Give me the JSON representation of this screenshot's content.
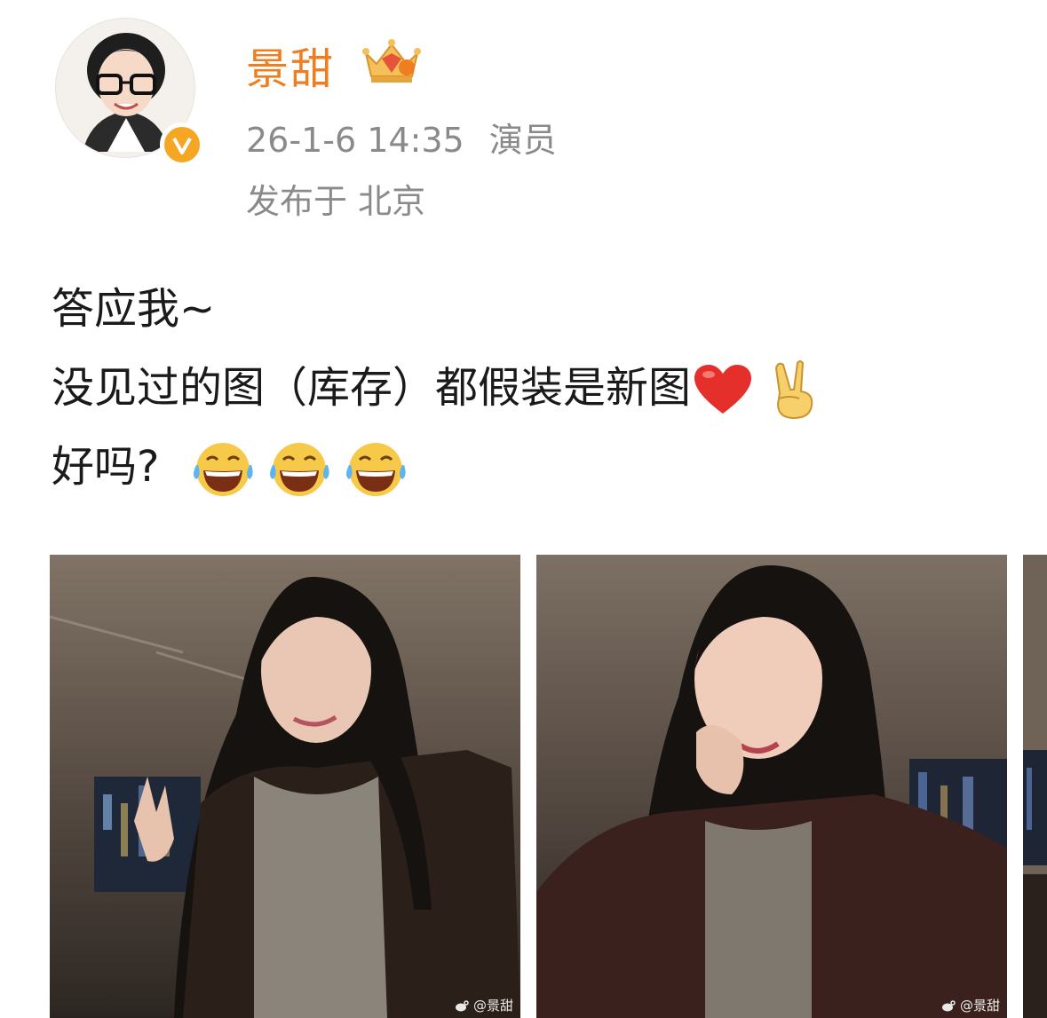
{
  "post": {
    "username": "景甜",
    "timestamp": "26-1-6 14:35",
    "source": "演员",
    "location": "发布于 北京",
    "text_line1": "答应我~",
    "text_line2": "没见过的图（库存）都假装是新图",
    "text_line3": "好吗?"
  },
  "badges": {
    "verified": "V"
  },
  "images": [
    {
      "watermark": "@景甜"
    },
    {
      "watermark": "@景甜"
    }
  ],
  "colors": {
    "username": "#f07d1f",
    "meta": "#8a8a8a",
    "verified_badge": "#f5a623"
  },
  "icons": [
    "crown-icon",
    "heart-emoji",
    "victory-hand-emoji",
    "tears-of-joy-emoji",
    "weibo-icon"
  ]
}
